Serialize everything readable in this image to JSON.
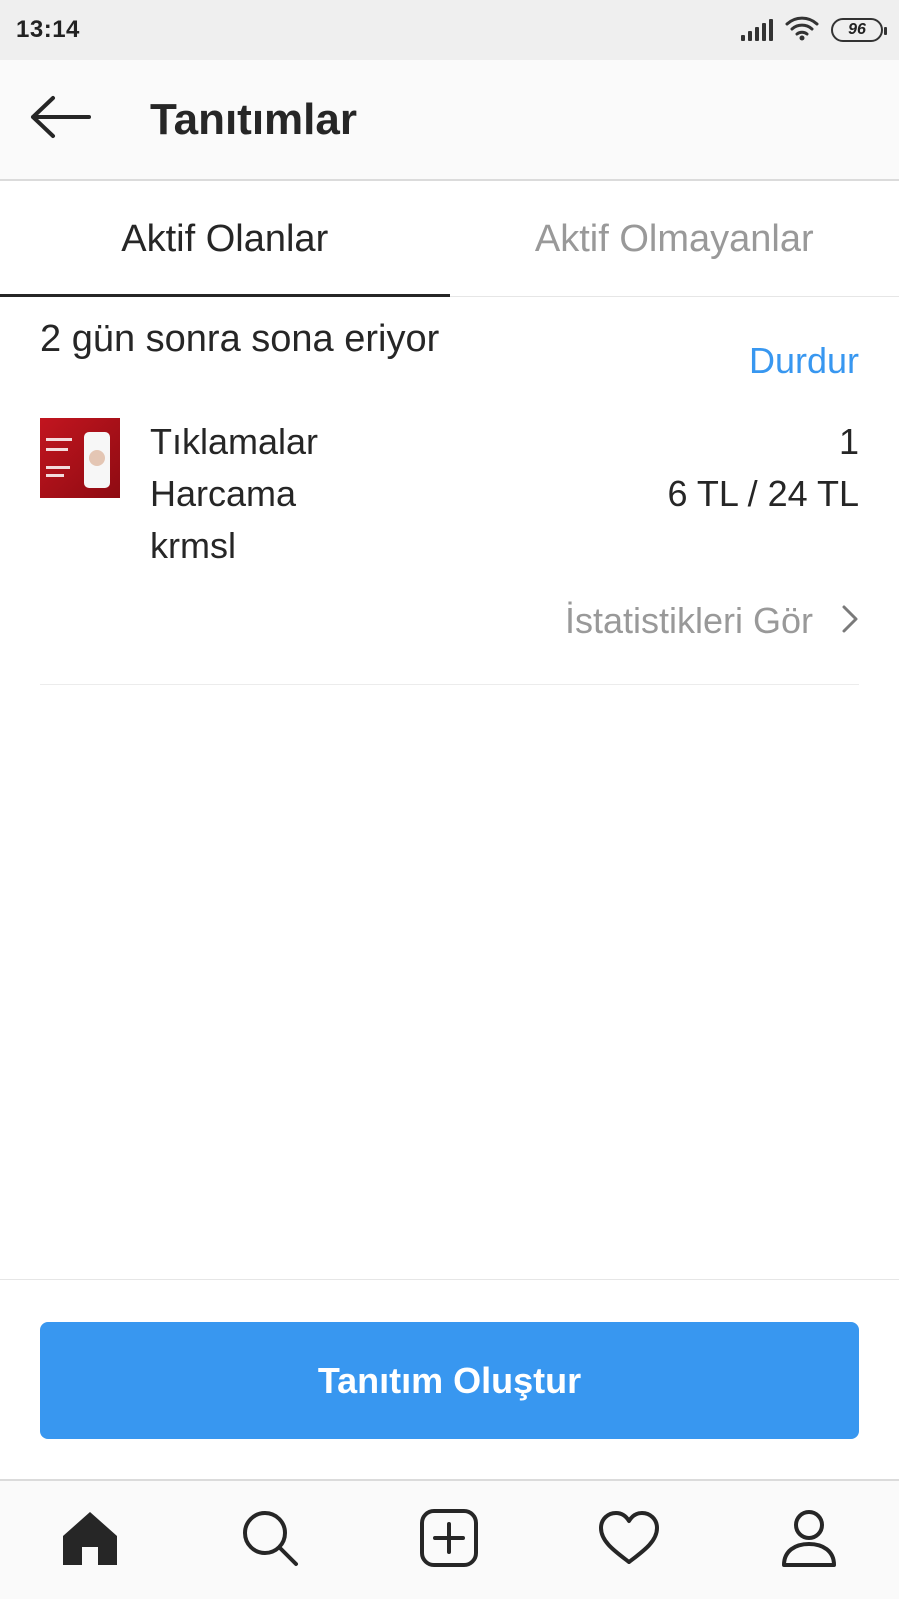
{
  "status_bar": {
    "time": "13:14",
    "battery": "96",
    "icons": [
      "signal-icon",
      "wifi-icon",
      "battery-icon"
    ]
  },
  "header": {
    "title": "Tanıtımlar",
    "back_icon": "arrow-left-icon"
  },
  "tabs": [
    {
      "label": "Aktif Olanlar",
      "active": true
    },
    {
      "label": "Aktif Olmayanlar",
      "active": false
    }
  ],
  "promotion": {
    "expires_text": "2 gün sonra sona eriyor",
    "stop_label": "Durdur",
    "metrics": [
      {
        "label": "Tıklamalar",
        "value": "1"
      },
      {
        "label": "Harcama",
        "value": "6 TL / 24 TL"
      }
    ],
    "account": "krmsl",
    "stats_label": "İstatistikleri Gör",
    "stats_icon": "chevron-right-icon"
  },
  "actions": {
    "create_label": "Tanıtım Oluştur"
  },
  "bottom_nav": [
    "home-icon",
    "search-icon",
    "add-post-icon",
    "heart-icon",
    "profile-icon"
  ],
  "colors": {
    "accent": "#3897f0",
    "text": "#262626",
    "muted": "#999999",
    "thumbnail": "#c2151f"
  }
}
